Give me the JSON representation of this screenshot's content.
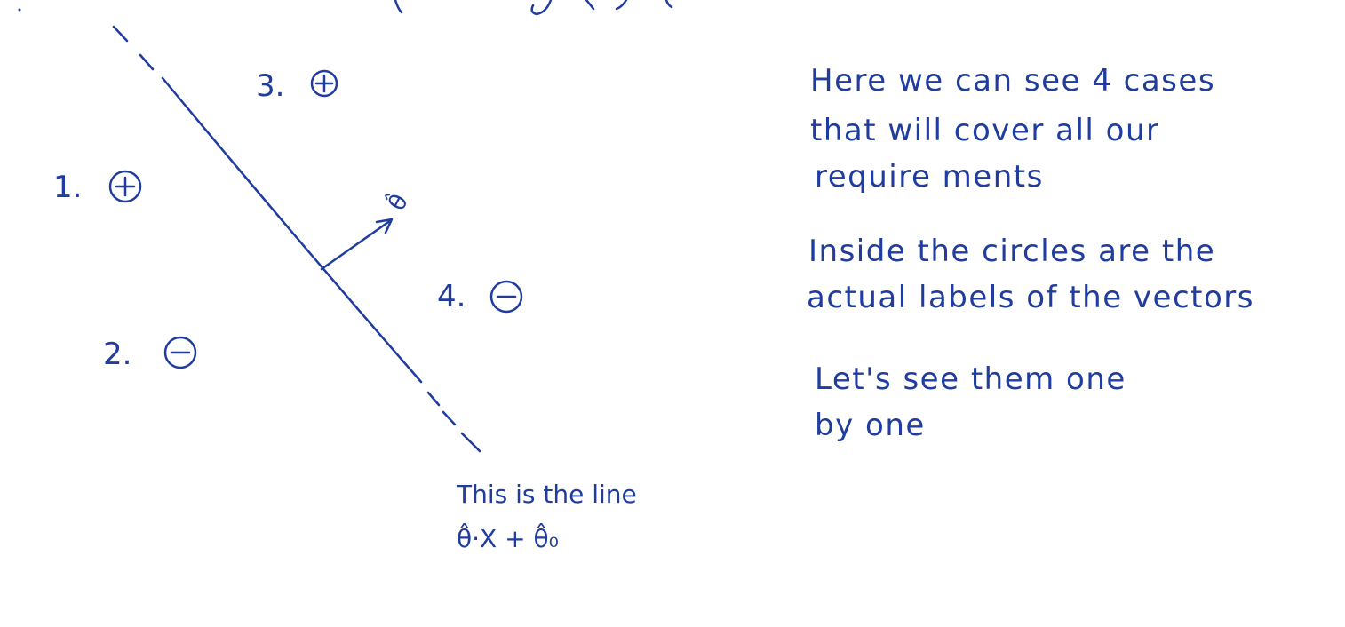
{
  "diagram": {
    "cases": [
      {
        "number": "1.",
        "sign": "+"
      },
      {
        "number": "2.",
        "sign": "-"
      },
      {
        "number": "3.",
        "sign": "+"
      },
      {
        "number": "4.",
        "sign": "-"
      }
    ],
    "vector_label": "θ̂",
    "line_caption": "This is the line",
    "line_equation": "θ̂·X + θ̂₀"
  },
  "notes": {
    "paragraph1": [
      "Here we can see 4 cases",
      "that will cover all our",
      "require ments"
    ],
    "paragraph2": [
      "Inside the circles are the",
      "actual labels of the vectors"
    ],
    "paragraph3": [
      "Let's see them one",
      "by one"
    ]
  },
  "colors": {
    "ink": "#1f3c9e",
    "paper": "#ffffff"
  }
}
